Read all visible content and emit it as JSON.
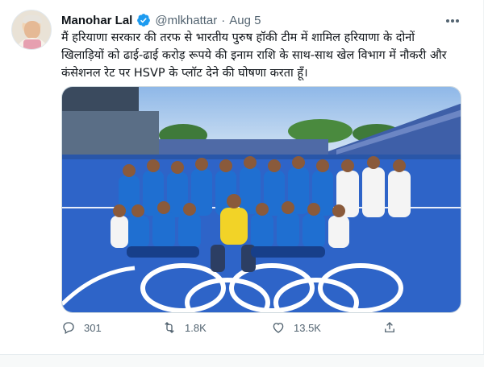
{
  "tweet": {
    "author_name": "Manohar Lal",
    "handle": "@mlkhattar",
    "separator": "·",
    "date": "Aug 5",
    "text": "मैं हरियाणा सरकार की तरफ से भारतीय पुरुष हॉकी टीम में शामिल हरियाणा के दोनों खिलाड़ियों को ढाई-ढाई करोड़ रूपये की इनाम राशि के साथ-साथ खेल विभाग में नौकरी और कंसेशनल रेट पर HSVP के प्लॉट देने की घोषणा करता हूँ।",
    "photo_description_icon": "team-photo",
    "actions": {
      "reply_count": "301",
      "retweet_count": "1.8K",
      "like_count": "13.5K"
    }
  },
  "colors": {
    "verified_blue": "#1d9bf0",
    "pitch_blue": "#2e64c8",
    "secondary_text": "#536471"
  },
  "icons": [
    "verified-badge-icon",
    "more-options-icon",
    "reply-icon",
    "retweet-icon",
    "like-icon",
    "share-icon"
  ]
}
